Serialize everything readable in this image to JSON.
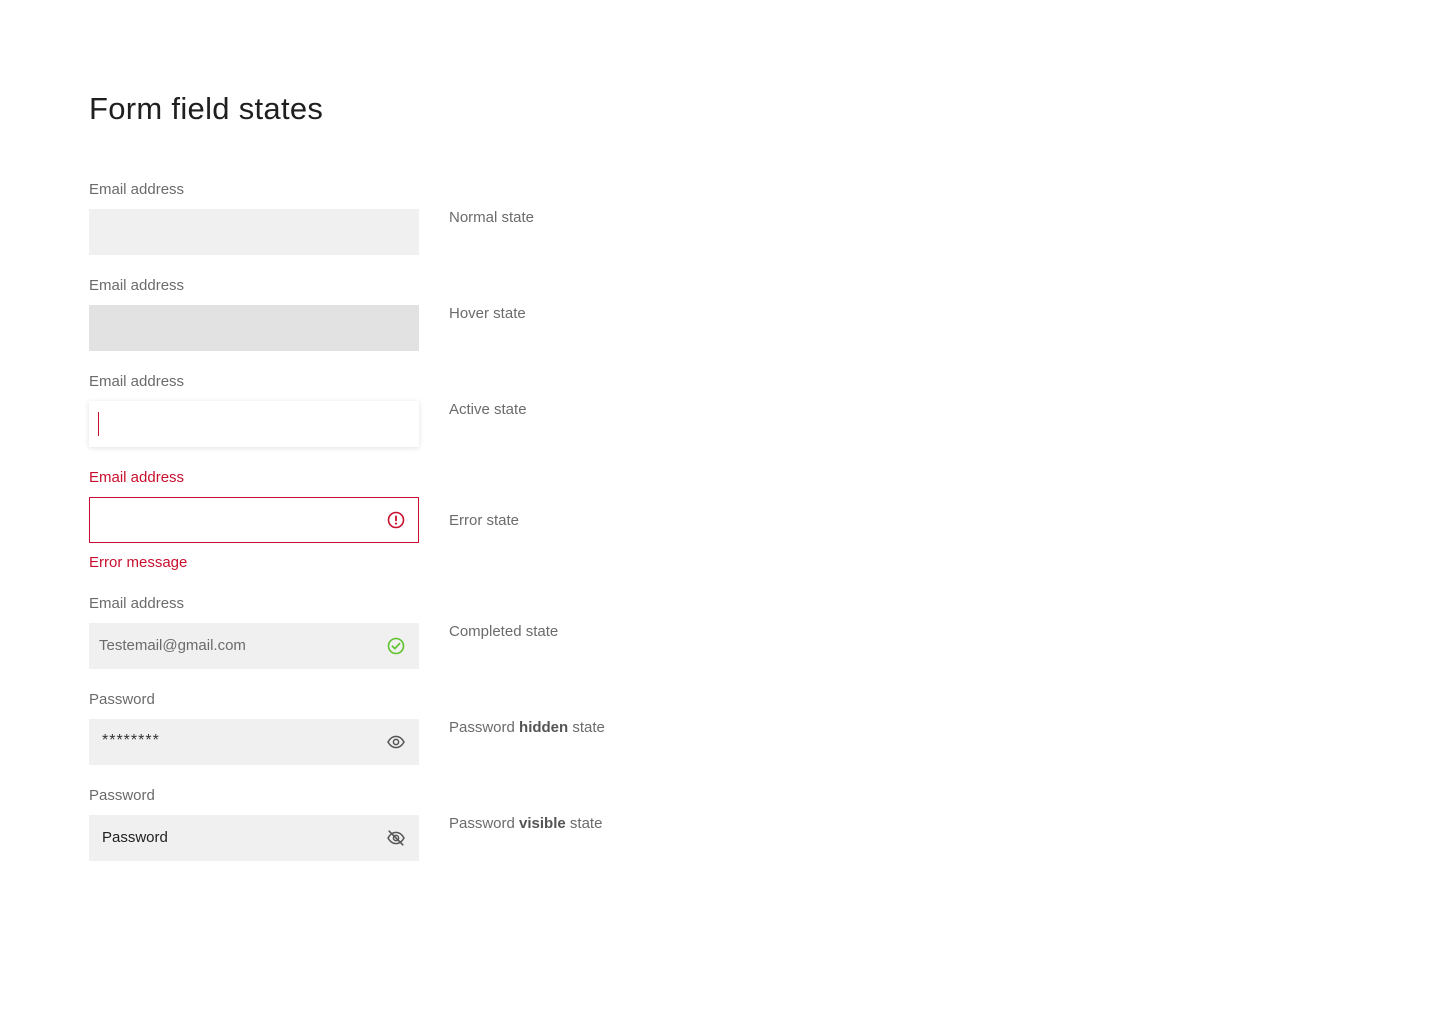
{
  "page": {
    "title": "Form field states"
  },
  "colors": {
    "error": "#c8102e",
    "success": "#5ec22b",
    "field_bg": "#f0f0f0",
    "field_bg_hover": "#e2e2e2"
  },
  "fields": [
    {
      "label": "Email address",
      "value": "",
      "state_note": "Normal state"
    },
    {
      "label": "Email address",
      "value": "",
      "state_note": "Hover state"
    },
    {
      "label": "Email address",
      "value": "",
      "state_note": "Active state"
    },
    {
      "label": "Email address",
      "value": "",
      "icon": "error-icon",
      "error_message": "Error message",
      "state_note": "Error state"
    },
    {
      "label": "Email address",
      "value": "Testemail@gmail.com",
      "icon": "check-circle-icon",
      "state_note": "Completed state"
    },
    {
      "label": "Password",
      "value": "********",
      "icon": "eye-icon",
      "state_note_prefix": "Password ",
      "state_note_bold": "hidden",
      "state_note_suffix": " state"
    },
    {
      "label": "Password",
      "value": "Password",
      "icon": "eye-off-icon",
      "state_note_prefix": "Password ",
      "state_note_bold": "visible",
      "state_note_suffix": " state"
    }
  ]
}
